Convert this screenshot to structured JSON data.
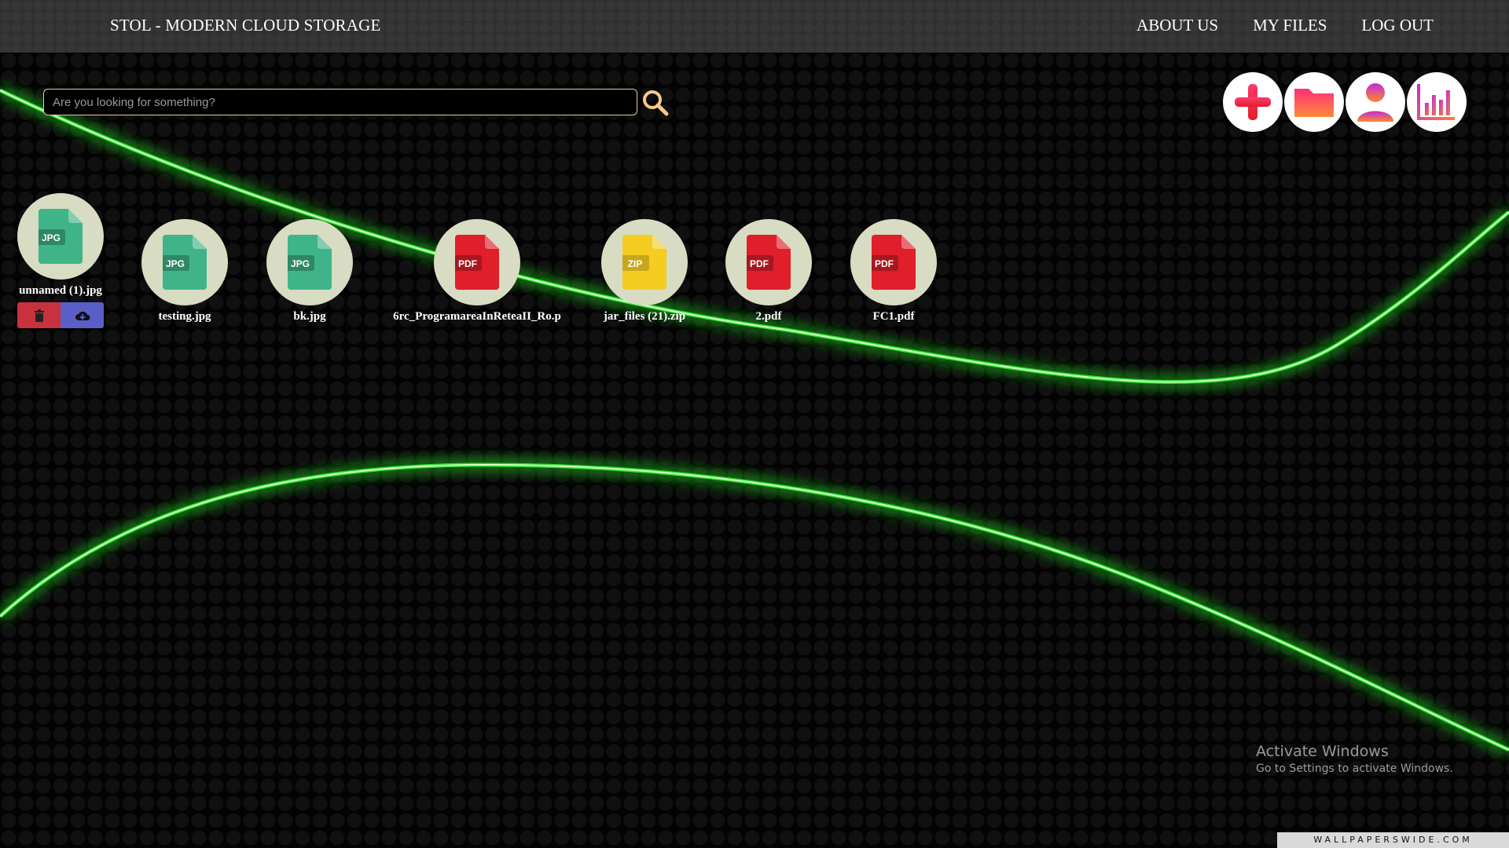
{
  "app": {
    "brand": "STOL - MODERN CLOUD STORAGE"
  },
  "nav": {
    "items": [
      {
        "label": "ABOUT US"
      },
      {
        "label": "MY FILES"
      },
      {
        "label": "LOG OUT"
      }
    ]
  },
  "search": {
    "placeholder": "Are you looking for something?",
    "value": ""
  },
  "actions": [
    {
      "icon": "plus-icon"
    },
    {
      "icon": "folder-icon"
    },
    {
      "icon": "user-icon"
    },
    {
      "icon": "chart-icon"
    }
  ],
  "files": [
    {
      "name": "unnamed (1).jpg",
      "type": "JPG",
      "color": "#3fb489",
      "selected": true
    },
    {
      "name": "testing.jpg",
      "type": "JPG",
      "color": "#3fb489"
    },
    {
      "name": "bk.jpg",
      "type": "JPG",
      "color": "#3fb489"
    },
    {
      "name": "6rc_ProgramareaInReteaII_Ro.p",
      "type": "PDF",
      "color": "#e01f2a"
    },
    {
      "name": "jar_files (21).zip",
      "type": "ZIP",
      "color": "#f4cc22"
    },
    {
      "name": "2.pdf",
      "type": "PDF",
      "color": "#e01f2a"
    },
    {
      "name": "FC1.pdf",
      "type": "PDF",
      "color": "#e01f2a"
    }
  ],
  "file_controls": {
    "delete_icon": "trash-icon",
    "download_icon": "cloud-download-icon"
  },
  "watermark": {
    "title": "Activate Windows",
    "subtitle": "Go to Settings to activate Windows."
  },
  "credit": "WALLPAPERSWIDE.COM"
}
